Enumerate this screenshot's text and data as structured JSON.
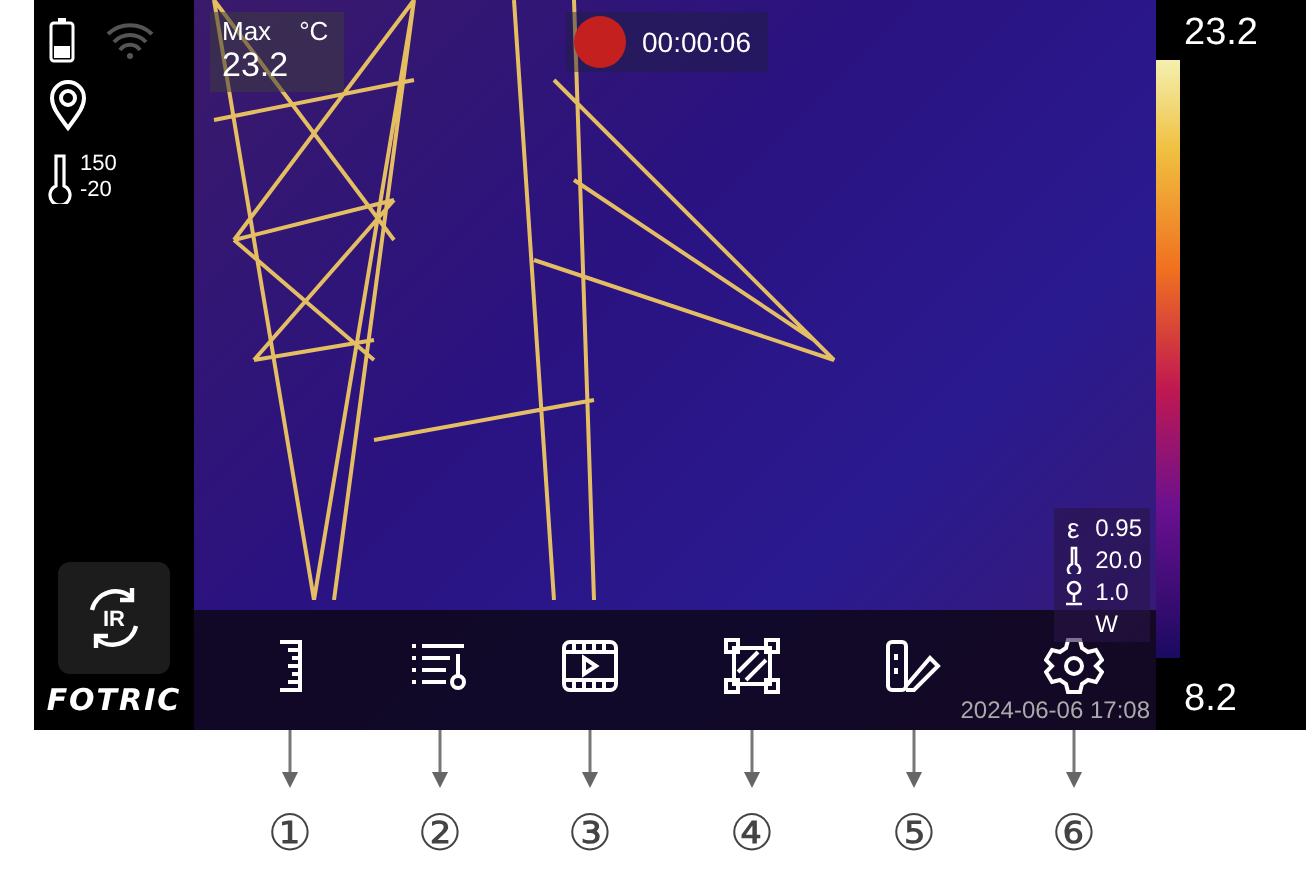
{
  "temp_range": {
    "high": "150",
    "low": "-20"
  },
  "mode_button": {
    "label": "IR"
  },
  "logo": "FOTRIC",
  "measurement": {
    "label": "Max",
    "unit": "°C",
    "value": "23.2"
  },
  "recording": {
    "on": true,
    "time": "00:00:06"
  },
  "params": [
    {
      "kind": "emissivity",
      "symbol": "ε",
      "value": "0.95"
    },
    {
      "kind": "temperature",
      "value": "20.0"
    },
    {
      "kind": "distance",
      "value": "1.0"
    },
    {
      "kind": "other",
      "value": "W"
    }
  ],
  "timestamp": "2024-06-06 17:08",
  "scale": {
    "max": "23.2",
    "min": "8.2"
  },
  "toolbar": [
    {
      "kind": "ruler"
    },
    {
      "kind": "levels"
    },
    {
      "kind": "video"
    },
    {
      "kind": "area"
    },
    {
      "kind": "palette"
    },
    {
      "kind": "settings"
    }
  ],
  "callouts": [
    "①",
    "②",
    "③",
    "④",
    "⑤",
    "⑥"
  ]
}
